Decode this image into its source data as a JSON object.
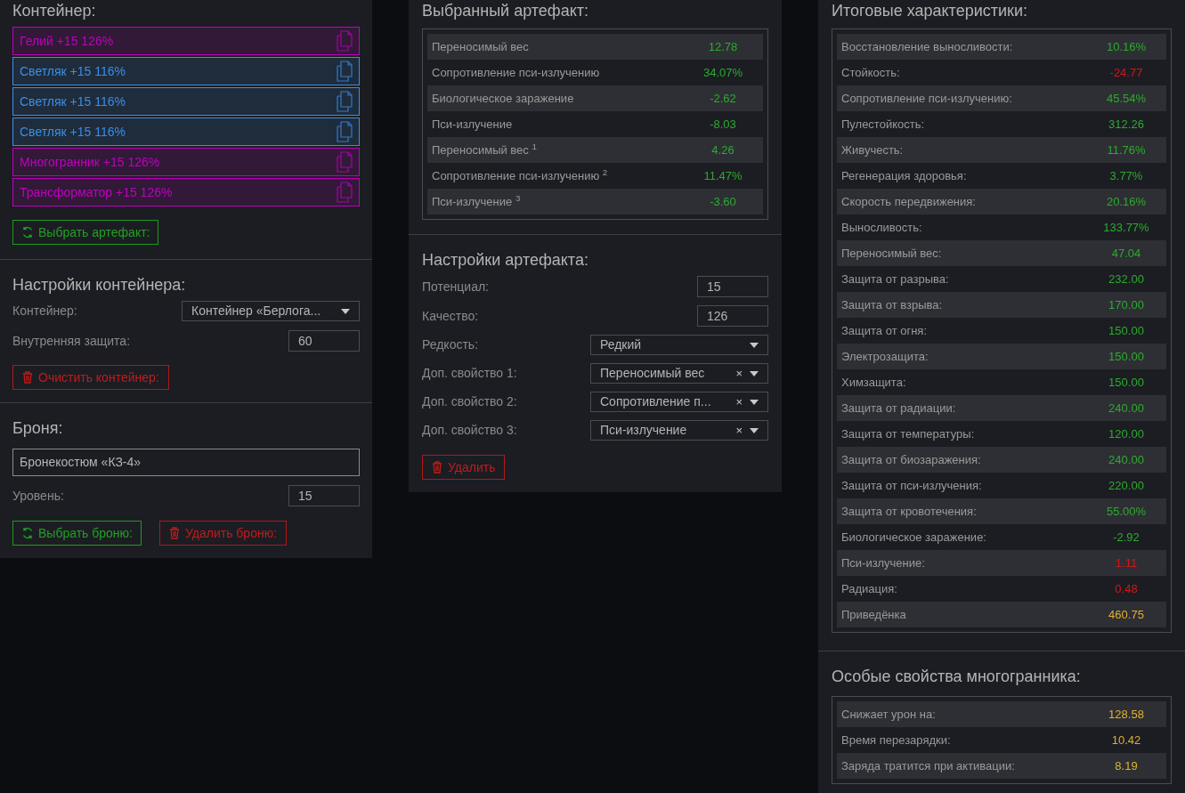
{
  "container": {
    "title": "Контейнер:",
    "artifacts": [
      {
        "label": "Гелий +15 126%",
        "color": "#c000c0"
      },
      {
        "label": "Светляк +15 116%",
        "color": "#3a8ee6"
      },
      {
        "label": "Светляк +15 116%",
        "color": "#3a8ee6"
      },
      {
        "label": "Светляк +15 116%",
        "color": "#3a8ee6"
      },
      {
        "label": "Многогранник +15 126%",
        "color": "#c000c0"
      },
      {
        "label": "Трансформатор +15 126%",
        "color": "#c000c0"
      }
    ],
    "pick_button": "Выбрать артефакт:"
  },
  "container_settings": {
    "title": "Настройки контейнера:",
    "container_label": "Контейнер:",
    "container_value": "Контейнер «Берлога...",
    "protection_label": "Внутренняя защита:",
    "protection_value": "60",
    "clear_button": "Очистить контейнер:"
  },
  "armor": {
    "title": "Броня:",
    "name": "Бронекостюм «КЗ-4»",
    "level_label": "Уровень:",
    "level_value": "15",
    "pick_button": "Выбрать броню:",
    "delete_button": "Удалить броню:"
  },
  "selected_artifact": {
    "title": "Выбранный артефакт:",
    "rows": [
      {
        "label": "Переносимый вес",
        "value": "12.78",
        "color": "#2eaa2e"
      },
      {
        "label": "Сопротивление пси-излучению",
        "value": "34.07%",
        "color": "#2eaa2e"
      },
      {
        "label": "Биологическое заражение",
        "value": "-2.62",
        "color": "#2eaa2e"
      },
      {
        "label": "Пси-излучение",
        "value": "-8.03",
        "color": "#2eaa2e"
      },
      {
        "label": "Переносимый вес $^{1}$",
        "value": "4.26",
        "color": "#2eaa2e"
      },
      {
        "label": "Сопротивление пси-излучению $^{2}$",
        "value": "11.47%",
        "color": "#2eaa2e"
      },
      {
        "label": "Пси-излучение $^{3}$",
        "value": "-3.60",
        "color": "#2eaa2e"
      }
    ]
  },
  "artifact_settings": {
    "title": "Настройки артефакта:",
    "fields": [
      {
        "kind": "number",
        "label": "Потенциал:",
        "value": "15"
      },
      {
        "kind": "number",
        "label": "Качество:",
        "value": "126"
      },
      {
        "kind": "select",
        "label": "Редкость:",
        "value": "Редкий"
      },
      {
        "kind": "select",
        "label": "Доп. свойство 1:",
        "value": "Переносимый вес",
        "clear_glyph": "×"
      },
      {
        "kind": "select",
        "label": "Доп. свойство 2:",
        "value": "Сопротивление п...",
        "clear_glyph": "×"
      },
      {
        "kind": "select",
        "label": "Доп. свойство 3:",
        "value": "Пси-излучение",
        "clear_glyph": "×"
      }
    ],
    "delete_button": "Удалить"
  },
  "totals": {
    "title": "Итоговые характеристики:",
    "rows": [
      {
        "label": "Восстановление выносливости:",
        "value": "10.16%",
        "color": "#2eaa2e"
      },
      {
        "label": "Стойкость:",
        "value": "-24.77",
        "color": "#d01818"
      },
      {
        "label": "Сопротивление пси-излучению:",
        "value": "45.54%",
        "color": "#2eaa2e"
      },
      {
        "label": "Пулестойкость:",
        "value": "312.26",
        "color": "#2eaa2e"
      },
      {
        "label": "Живучесть:",
        "value": "11.76%",
        "color": "#2eaa2e"
      },
      {
        "label": "Регенерация здоровья:",
        "value": "3.77%",
        "color": "#2eaa2e"
      },
      {
        "label": "Скорость передвижения:",
        "value": "20.16%",
        "color": "#2eaa2e"
      },
      {
        "label": "Выносливость:",
        "value": "133.77%",
        "color": "#2eaa2e"
      },
      {
        "label": "Переносимый вес:",
        "value": "47.04",
        "color": "#2eaa2e"
      },
      {
        "label": "Защита от разрыва:",
        "value": "232.00",
        "color": "#2eaa2e"
      },
      {
        "label": "Защита от взрыва:",
        "value": "170.00",
        "color": "#2eaa2e"
      },
      {
        "label": "Защита от огня:",
        "value": "150.00",
        "color": "#2eaa2e"
      },
      {
        "label": "Электрозащита:",
        "value": "150.00",
        "color": "#2eaa2e"
      },
      {
        "label": "Химзащита:",
        "value": "150.00",
        "color": "#2eaa2e"
      },
      {
        "label": "Защита от радиации:",
        "value": "240.00",
        "color": "#2eaa2e"
      },
      {
        "label": "Защита от температуры:",
        "value": "120.00",
        "color": "#2eaa2e"
      },
      {
        "label": "Защита от биозаражения:",
        "value": "240.00",
        "color": "#2eaa2e"
      },
      {
        "label": "Защита от пси-излучения:",
        "value": "220.00",
        "color": "#2eaa2e"
      },
      {
        "label": "Защита от кровотечения:",
        "value": "55.00%",
        "color": "#2eaa2e"
      },
      {
        "label": "Биологическое заражение:",
        "value": "-2.92",
        "color": "#2eaa2e"
      },
      {
        "label": "Пси-излучение:",
        "value": "1.11",
        "color": "#d01818"
      },
      {
        "label": "Радиация:",
        "value": "0.48",
        "color": "#d01818"
      },
      {
        "label": "Приведёнка",
        "value": "460.75",
        "color": "#e0b030"
      }
    ]
  },
  "polyhedron": {
    "title": "Особые свойства многогранника:",
    "rows": [
      {
        "label": "Снижает урон на:",
        "value": "128.58",
        "color": "#e0b030"
      },
      {
        "label": "Время перезарядки:",
        "value": "10.42",
        "color": "#e0b030"
      },
      {
        "label": "Заряда тратится при активации:",
        "value": "8.19",
        "color": "#e0b030"
      }
    ]
  }
}
